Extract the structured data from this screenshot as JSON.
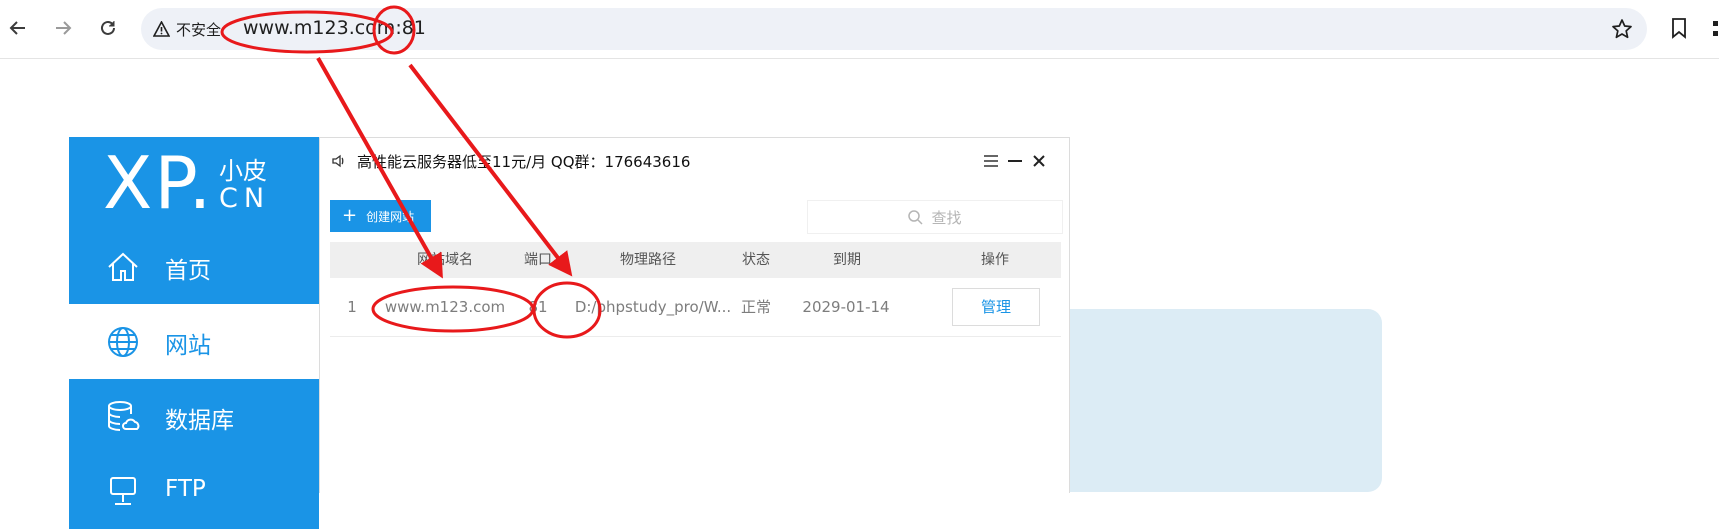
{
  "browser": {
    "security_text": "不安全",
    "url_host": "www.m123.com",
    "url_port": ":81"
  },
  "sidebar": {
    "logo_text": "XP.",
    "logo_subtitle": "小皮",
    "logo_cn": "CN",
    "items": [
      {
        "label": "首页",
        "icon": "home-icon"
      },
      {
        "label": "网站",
        "icon": "globe-icon"
      },
      {
        "label": "数据库",
        "icon": "database-icon"
      },
      {
        "label": "FTP",
        "icon": "ftp-icon"
      }
    ]
  },
  "dialog": {
    "title": "高性能云服务器低至11元/月  QQ群：176643616",
    "create_label": "创建网站",
    "search_placeholder": "查找",
    "columns": [
      "网站域名",
      "端口",
      "物理路径",
      "状态",
      "到期",
      "操作"
    ],
    "rows": [
      {
        "index": "1",
        "domain": "www.m123.com",
        "port": "81",
        "path": "D:/phpstudy_pro/W...",
        "status": "正常",
        "expiry": "2029-01-14",
        "action": "管理"
      }
    ]
  },
  "colors": {
    "brand_blue": "#1a94e6",
    "annotation_red": "#e8191b",
    "light_panel": "#dcecf5"
  }
}
